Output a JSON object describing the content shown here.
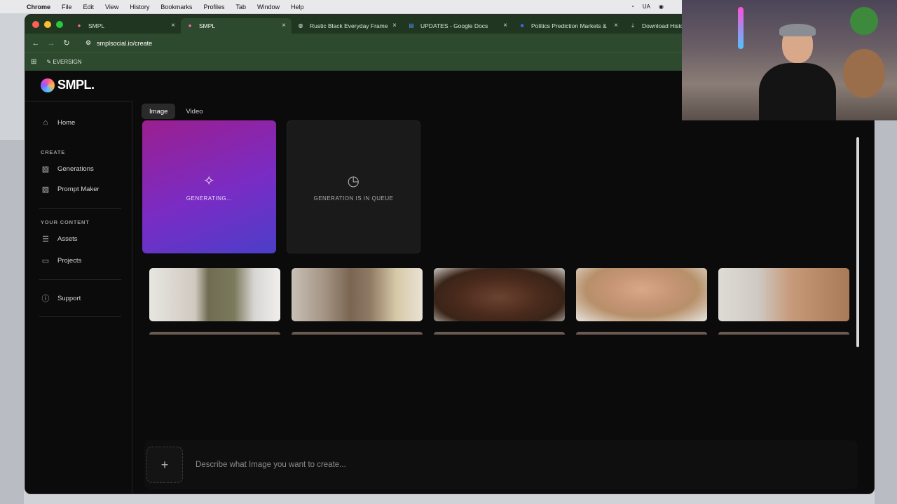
{
  "menubar": {
    "app": "Chrome",
    "items": [
      "File",
      "Edit",
      "View",
      "History",
      "Bookmarks",
      "Profiles",
      "Tab",
      "Window",
      "Help"
    ],
    "status_text": "UA"
  },
  "tabs": [
    {
      "title": "SMPL",
      "icon": "smpl-favicon"
    },
    {
      "title": "SMPL",
      "icon": "smpl-favicon"
    },
    {
      "title": "Rustic Black Everyday Frame",
      "icon": "globe-icon"
    },
    {
      "title": "UPDATES - Google Docs",
      "icon": "docs-icon"
    },
    {
      "title": "Politics Prediction Markets &",
      "icon": "polymarket-icon"
    },
    {
      "title": "Download History",
      "icon": "download-icon"
    }
  ],
  "address": {
    "url": "smplsocial.io/create"
  },
  "bookmarks": [
    {
      "label": "EVERSIGN"
    }
  ],
  "app": {
    "logo_text": "SMPL.",
    "sidebar": {
      "home": "Home",
      "create_heading": "CREATE",
      "generations": "Generations",
      "prompt_maker": "Prompt Maker",
      "content_heading": "YOUR CONTENT",
      "assets": "Assets",
      "projects": "Projects",
      "support": "Support"
    },
    "mode_tabs": {
      "image": "Image",
      "video": "Video",
      "active": "Image"
    },
    "generating_label": "GENERATING...",
    "queue_label": "GENERATION IS IN QUEUE",
    "prompt": {
      "placeholder": "Describe what Image you want to create...",
      "value": ""
    }
  },
  "colors": {
    "browser_frame": "#2e4a2e",
    "tabbar": "#203620",
    "app_bg": "#0b0b0b",
    "generating_start": "#9b1f8f",
    "generating_end": "#4b3ec9"
  }
}
